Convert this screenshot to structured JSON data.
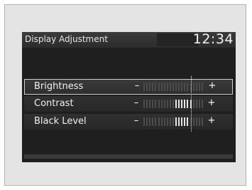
{
  "title": "Display Adjustment",
  "clock": "12:34",
  "colors": {
    "tick_active": "#e6e6e6",
    "tick_inactive": "#4c4c4c"
  },
  "settings": [
    {
      "label": "Brightness",
      "minus": "–",
      "plus": "+",
      "selected": true,
      "level": 0.5,
      "steps": 21
    },
    {
      "label": "Contrast",
      "minus": "–",
      "plus": "+",
      "selected": false,
      "level": 0.8,
      "steps": 21
    },
    {
      "label": "Black Level",
      "minus": "–",
      "plus": "+",
      "selected": false,
      "level": 0.76,
      "steps": 21
    }
  ]
}
